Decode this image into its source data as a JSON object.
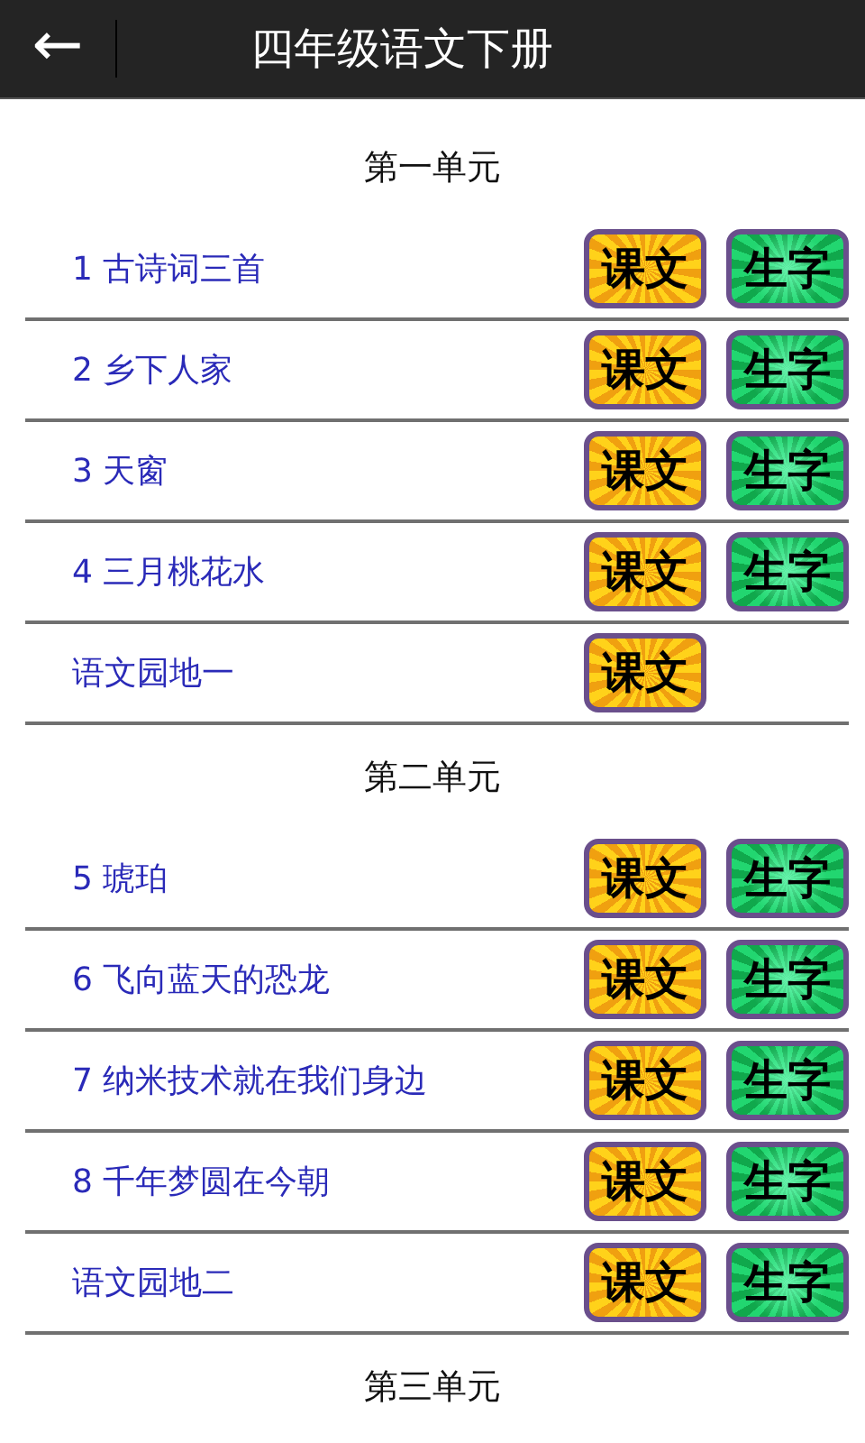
{
  "header": {
    "back_icon": "←",
    "title": "四年级语文下册"
  },
  "units": [
    {
      "title": "第一单元",
      "lessons": [
        {
          "title": "1 古诗词三首",
          "buttons": [
            {
              "kind": "text",
              "label": "课文"
            },
            {
              "kind": "chars",
              "label": "生字"
            }
          ]
        },
        {
          "title": "2 乡下人家",
          "buttons": [
            {
              "kind": "text",
              "label": "课文"
            },
            {
              "kind": "chars",
              "label": "生字"
            }
          ]
        },
        {
          "title": "3 天窗",
          "buttons": [
            {
              "kind": "text",
              "label": "课文"
            },
            {
              "kind": "chars",
              "label": "生字"
            }
          ]
        },
        {
          "title": "4 三月桃花水",
          "buttons": [
            {
              "kind": "text",
              "label": "课文"
            },
            {
              "kind": "chars",
              "label": "生字"
            }
          ]
        },
        {
          "title": "语文园地一",
          "buttons": [
            {
              "kind": "text",
              "label": "课文"
            }
          ]
        }
      ]
    },
    {
      "title": "第二单元",
      "lessons": [
        {
          "title": "5 琥珀",
          "buttons": [
            {
              "kind": "text",
              "label": "课文"
            },
            {
              "kind": "chars",
              "label": "生字"
            }
          ]
        },
        {
          "title": "6 飞向蓝天的恐龙",
          "buttons": [
            {
              "kind": "text",
              "label": "课文"
            },
            {
              "kind": "chars",
              "label": "生字"
            }
          ]
        },
        {
          "title": "7 纳米技术就在我们身边",
          "buttons": [
            {
              "kind": "text",
              "label": "课文"
            },
            {
              "kind": "chars",
              "label": "生字"
            }
          ]
        },
        {
          "title": "8 千年梦圆在今朝",
          "buttons": [
            {
              "kind": "text",
              "label": "课文"
            },
            {
              "kind": "chars",
              "label": "生字"
            }
          ]
        },
        {
          "title": "语文园地二",
          "buttons": [
            {
              "kind": "text",
              "label": "课文"
            },
            {
              "kind": "chars",
              "label": "生字"
            }
          ]
        }
      ]
    },
    {
      "title": "第三单元"
    }
  ]
}
